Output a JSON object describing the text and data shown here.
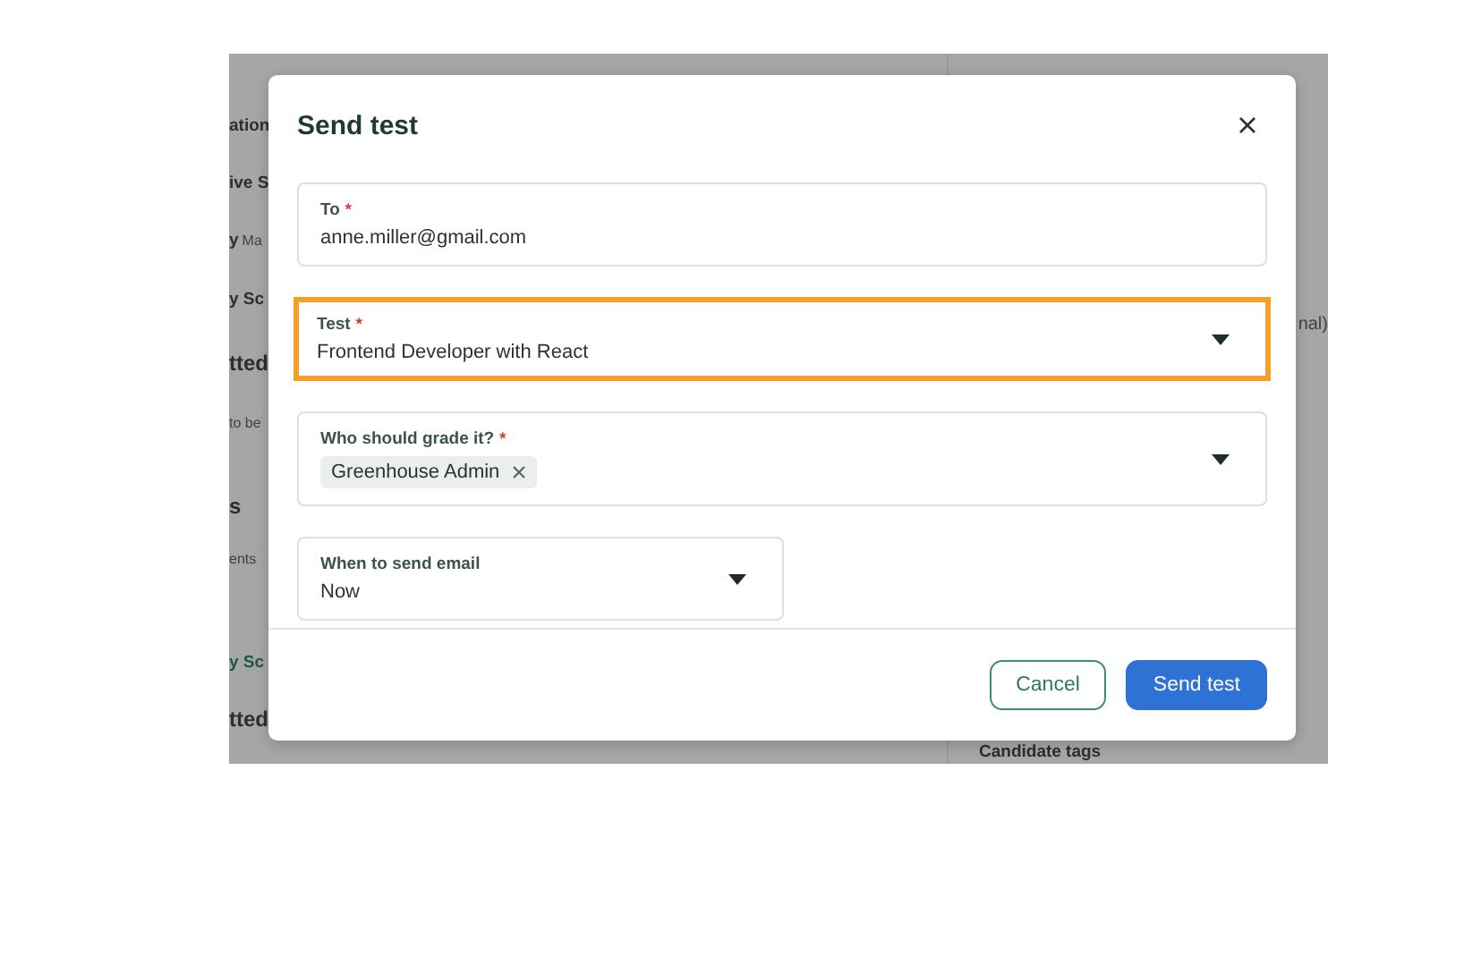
{
  "background": {
    "left_rows": [
      {
        "parts": [
          {
            "text": "ation",
            "kind": "label"
          }
        ]
      },
      {
        "parts": [
          {
            "text": "ive S",
            "kind": "label"
          }
        ]
      },
      {
        "parts": [
          {
            "text": "y",
            "kind": "label"
          },
          {
            "text": "Ma",
            "kind": "muted"
          }
        ]
      },
      {
        "parts": [
          {
            "text": "y Sc",
            "kind": "label"
          }
        ]
      },
      {
        "parts": [
          {
            "text": "tted",
            "kind": "heading"
          }
        ]
      },
      {
        "parts": [
          {
            "text": "to be",
            "kind": "muted"
          }
        ]
      },
      {
        "parts": [
          {
            "text": "s",
            "kind": "heading"
          }
        ]
      },
      {
        "parts": [
          {
            "text": "ents",
            "kind": "muted"
          }
        ]
      },
      {
        "parts": [
          {
            "text": "y Sc",
            "kind": "link"
          }
        ]
      },
      {
        "parts": [
          {
            "text": "tted",
            "kind": "heading"
          }
        ]
      }
    ],
    "right_texts": [
      {
        "text": "nal)",
        "kind": "muted"
      },
      {
        "text": "Candidate tags",
        "kind": "label"
      }
    ]
  },
  "dialog": {
    "title": "Send test",
    "fields": [
      {
        "kind": "text",
        "label": "To",
        "required_mark": "*",
        "value": "anne.miller@gmail.com",
        "highlighted": false
      },
      {
        "kind": "select",
        "label": "Test",
        "required_mark": "*",
        "value": "Frontend Developer with React",
        "highlighted": true
      },
      {
        "kind": "multiselect",
        "label": "Who should grade it?",
        "required_mark": "*",
        "tags": [
          {
            "label": "Greenhouse Admin"
          }
        ],
        "highlighted": false
      },
      {
        "kind": "select",
        "label": "When to send email",
        "value": "Now",
        "highlighted": false
      }
    ],
    "buttons": [
      {
        "label": "Cancel",
        "kind": "secondary"
      },
      {
        "label": "Send test",
        "kind": "primary"
      }
    ]
  }
}
